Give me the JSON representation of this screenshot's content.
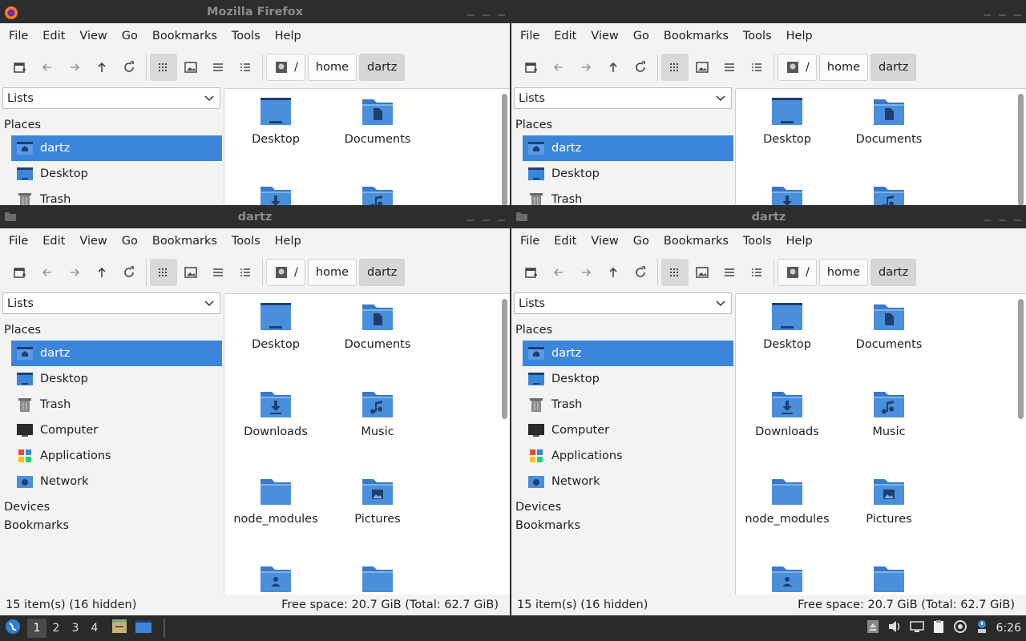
{
  "windows": [
    {
      "title": "Mozilla Firefox"
    },
    {
      "title": "dartz"
    },
    {
      "title": "dartz"
    }
  ],
  "menu": [
    "File",
    "Edit",
    "View",
    "Go",
    "Bookmarks",
    "Tools",
    "Help"
  ],
  "breadcrumbs": [
    "/",
    "home",
    "dartz"
  ],
  "sidebar": {
    "combo": "Lists",
    "places_header": "Places",
    "places": [
      {
        "label": "dartz",
        "icon": "home-folder-icon"
      },
      {
        "label": "Desktop",
        "icon": "desktop-icon"
      },
      {
        "label": "Trash",
        "icon": "trash-icon"
      },
      {
        "label": "Computer",
        "icon": "computer-icon"
      },
      {
        "label": "Applications",
        "icon": "applications-icon"
      },
      {
        "label": "Network",
        "icon": "network-icon"
      }
    ],
    "devices_header": "Devices",
    "bookmarks_header": "Bookmarks"
  },
  "files": [
    {
      "label": "Desktop",
      "icon": "desktop-folder-icon"
    },
    {
      "label": "Documents",
      "icon": "documents-folder-icon"
    },
    {
      "label": "Downloads",
      "icon": "downloads-folder-icon"
    },
    {
      "label": "Music",
      "icon": "music-folder-icon"
    },
    {
      "label": "node_modules",
      "icon": "folder-icon"
    },
    {
      "label": "Pictures",
      "icon": "pictures-folder-icon"
    },
    {
      "label": "",
      "icon": "public-folder-icon"
    },
    {
      "label": "",
      "icon": "folder-icon"
    }
  ],
  "status": {
    "items": "15 item(s) (16 hidden)",
    "free": "Free space: 20.7 GiB (Total: 62.7 GiB)"
  },
  "taskbar": {
    "workspaces": [
      "1",
      "2",
      "3",
      "4"
    ],
    "clock": "6:26"
  },
  "colors": {
    "accent": "#3b86da",
    "folder": "#4a8fdb",
    "titlebar": "#2d2d2d"
  }
}
